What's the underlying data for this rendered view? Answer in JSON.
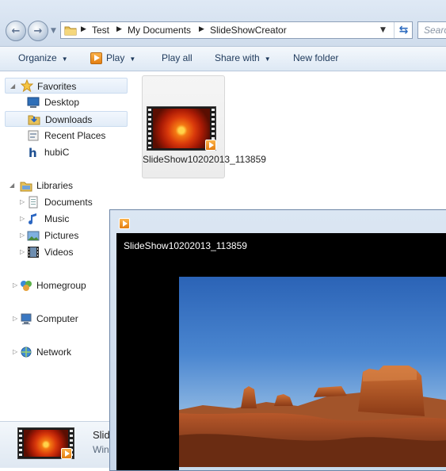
{
  "address": {
    "crumbs": [
      "Test",
      "My Documents",
      "SlideShowCreator"
    ],
    "search_placeholder": "Search"
  },
  "toolbar": {
    "organize": "Organize",
    "play": "Play",
    "play_all": "Play all",
    "share_with": "Share with",
    "new_folder": "New folder"
  },
  "nav": {
    "favorites": "Favorites",
    "desktop": "Desktop",
    "downloads": "Downloads",
    "recent_places": "Recent Places",
    "hubic": "hubiC",
    "libraries": "Libraries",
    "documents": "Documents",
    "music": "Music",
    "pictures": "Pictures",
    "videos": "Videos",
    "homegroup": "Homegroup",
    "computer": "Computer",
    "network": "Network"
  },
  "file": {
    "name": "SlideShow10202013_113859"
  },
  "details": {
    "name": "Slid",
    "type": "Win"
  },
  "player": {
    "title": "SlideShow10202013_113859"
  },
  "colors": {
    "accent": "#1e395b",
    "selection": "#e2ecf8",
    "video_background": "#000000"
  }
}
